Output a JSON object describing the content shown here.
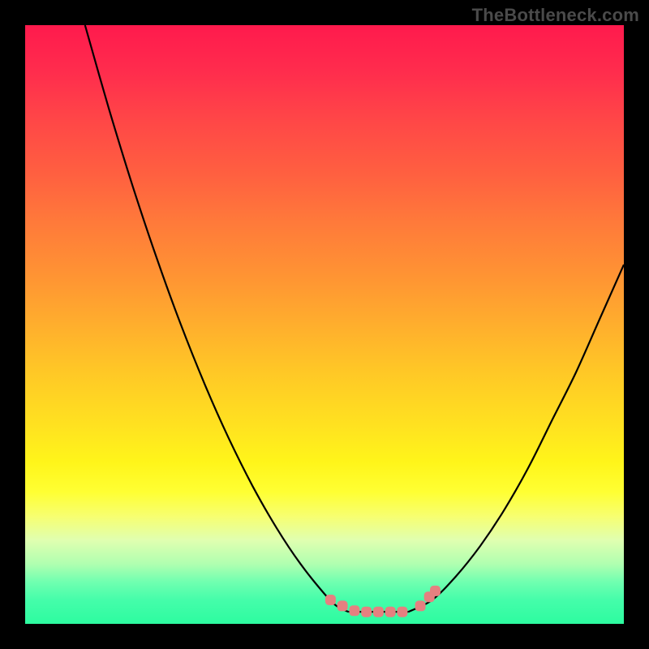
{
  "watermark": "TheBottleneck.com",
  "chart_data": {
    "type": "line",
    "title": "",
    "xlabel": "",
    "ylabel": "",
    "xlim": [
      0,
      100
    ],
    "ylim": [
      0,
      100
    ],
    "series": [
      {
        "name": "left-curve",
        "x": [
          10.0,
          14.0,
          18.0,
          22.0,
          26.0,
          30.0,
          34.0,
          38.0,
          42.0,
          46.0,
          50.0,
          52.0,
          54.0
        ],
        "y": [
          100.0,
          86.0,
          73.0,
          61.0,
          50.0,
          40.0,
          31.0,
          23.0,
          16.0,
          10.0,
          5.0,
          3.0,
          2.0
        ]
      },
      {
        "name": "flat-bottom",
        "x": [
          54.0,
          56.0,
          58.0,
          60.0,
          62.0,
          64.0
        ],
        "y": [
          2.0,
          2.0,
          2.0,
          2.0,
          2.0,
          2.0
        ]
      },
      {
        "name": "right-curve",
        "x": [
          64.0,
          68.0,
          72.0,
          76.0,
          80.0,
          84.0,
          88.0,
          92.0,
          96.0,
          100.0
        ],
        "y": [
          2.0,
          4.0,
          8.0,
          13.0,
          19.0,
          26.0,
          34.0,
          42.0,
          51.0,
          60.0
        ]
      }
    ],
    "markers": [
      {
        "name": "left-cluster-1",
        "x": 51.0,
        "y": 4.0
      },
      {
        "name": "left-cluster-2",
        "x": 53.0,
        "y": 3.0
      },
      {
        "name": "left-cluster-3",
        "x": 55.0,
        "y": 2.2
      },
      {
        "name": "bottom-1",
        "x": 57.0,
        "y": 2.0
      },
      {
        "name": "bottom-2",
        "x": 59.0,
        "y": 2.0
      },
      {
        "name": "bottom-3",
        "x": 61.0,
        "y": 2.0
      },
      {
        "name": "bottom-4",
        "x": 63.0,
        "y": 2.0
      },
      {
        "name": "right-cluster-1",
        "x": 66.0,
        "y": 3.0
      },
      {
        "name": "right-cluster-2",
        "x": 67.5,
        "y": 4.5
      },
      {
        "name": "right-cluster-3",
        "x": 68.5,
        "y": 5.5
      }
    ],
    "marker_color": "#e58080",
    "curve_color": "#000000"
  }
}
